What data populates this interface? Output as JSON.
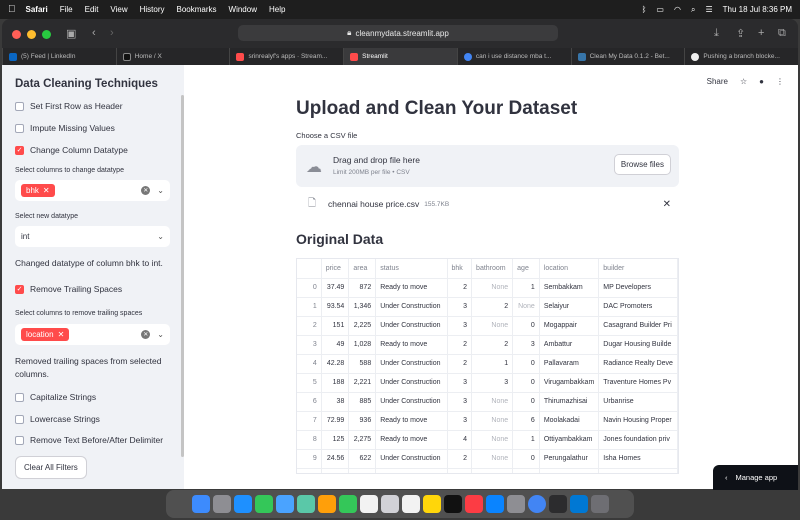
{
  "menubar": {
    "app": "Safari",
    "items": [
      "File",
      "Edit",
      "View",
      "History",
      "Bookmarks",
      "Window",
      "Help"
    ],
    "datetime": "Thu 18 Jul  8:36 PM"
  },
  "browser": {
    "url": "cleanmydata.streamlit.app",
    "tabs": [
      {
        "label": "(5) Feed | LinkedIn",
        "color": "#0a66c2"
      },
      {
        "label": "Home / X",
        "color": "#111111"
      },
      {
        "label": "srinrealyf's apps · Stream...",
        "color": "#ff4b4b"
      },
      {
        "label": "Streamlit",
        "color": "#ff4b4b",
        "active": true
      },
      {
        "label": "can i use distance mba t...",
        "color": "#4285f4"
      },
      {
        "label": "Clean My Data 0.1.2 - Bet...",
        "color": "#3775a9"
      },
      {
        "label": "Pushing a branch blocke...",
        "color": "#f0f0f0"
      }
    ]
  },
  "sidebar": {
    "title": "Data Cleaning Techniques",
    "set_header": "Set First Row as Header",
    "impute": "Impute Missing Values",
    "change_dtype": "Change Column Datatype",
    "cols_change_label": "Select columns to change datatype",
    "cols_change_chip": "bhk",
    "new_dtype_label": "Select new datatype",
    "new_dtype_value": "int",
    "dtype_msg": "Changed datatype of column bhk to int.",
    "trailing": "Remove Trailing Spaces",
    "cols_trailing_label": "Select columns to remove trailing spaces",
    "cols_trailing_chip": "location",
    "trailing_msg": "Removed trailing spaces from selected columns.",
    "capitalize": "Capitalize Strings",
    "lowercase": "Lowercase Strings",
    "delimiter": "Remove Text Before/After Delimiter",
    "clear_btn": "Clear All Filters"
  },
  "main": {
    "share": "Share",
    "title": "Upload and Clean Your Dataset",
    "upload_label": "Choose a CSV file",
    "drop_title": "Drag and drop file here",
    "drop_sub": "Limit 200MB per file • CSV",
    "browse": "Browse files",
    "file_name": "chennai house price.csv",
    "file_size": "155.7KB",
    "section_title": "Original Data"
  },
  "table": {
    "columns": [
      "",
      "price",
      "area",
      "status",
      "bhk",
      "bathroom",
      "age",
      "location",
      "builder"
    ],
    "rows": [
      [
        "0",
        "37.49",
        "872",
        "Ready to move",
        "2",
        "None",
        "1",
        "Sembakkam",
        "MP Developers"
      ],
      [
        "1",
        "93.54",
        "1,346",
        "Under Construction",
        "3",
        "2",
        "None",
        "Selaiyur",
        "DAC Promoters"
      ],
      [
        "2",
        "151",
        "2,225",
        "Under Construction",
        "3",
        "None",
        "0",
        "Mogappair",
        "Casagrand Builder Pri"
      ],
      [
        "3",
        "49",
        "1,028",
        "Ready to move",
        "2",
        "2",
        "3",
        "Ambattur",
        "Dugar Housing Builde"
      ],
      [
        "4",
        "42.28",
        "588",
        "Under Construction",
        "2",
        "1",
        "0",
        "Pallavaram",
        "Radiance Realty Deve"
      ],
      [
        "5",
        "188",
        "2,221",
        "Under Construction",
        "3",
        "3",
        "0",
        "Virugambakkam",
        "Traventure Homes Pv"
      ],
      [
        "6",
        "38",
        "885",
        "Under Construction",
        "3",
        "None",
        "0",
        "Thirumazhisai",
        "Urbanrise"
      ],
      [
        "7",
        "72.99",
        "936",
        "Ready to move",
        "3",
        "None",
        "6",
        "Moolakadai",
        "Navin Housing Proper"
      ],
      [
        "8",
        "125",
        "2,275",
        "Ready to move",
        "4",
        "None",
        "1",
        "Ottiyambakkam",
        "Jones foundation priv"
      ],
      [
        "9",
        "24.56",
        "622",
        "Under Construction",
        "2",
        "None",
        "0",
        "Perungalathur",
        "Isha Homes"
      ],
      [
        "10",
        "",
        "",
        "",
        "",
        "",
        "",
        "",
        ""
      ]
    ]
  },
  "manage_app": "Manage app",
  "colors": {
    "accent": "#ff4b4b",
    "sidebar_bg": "#f0f2f6",
    "text": "#31333f"
  }
}
